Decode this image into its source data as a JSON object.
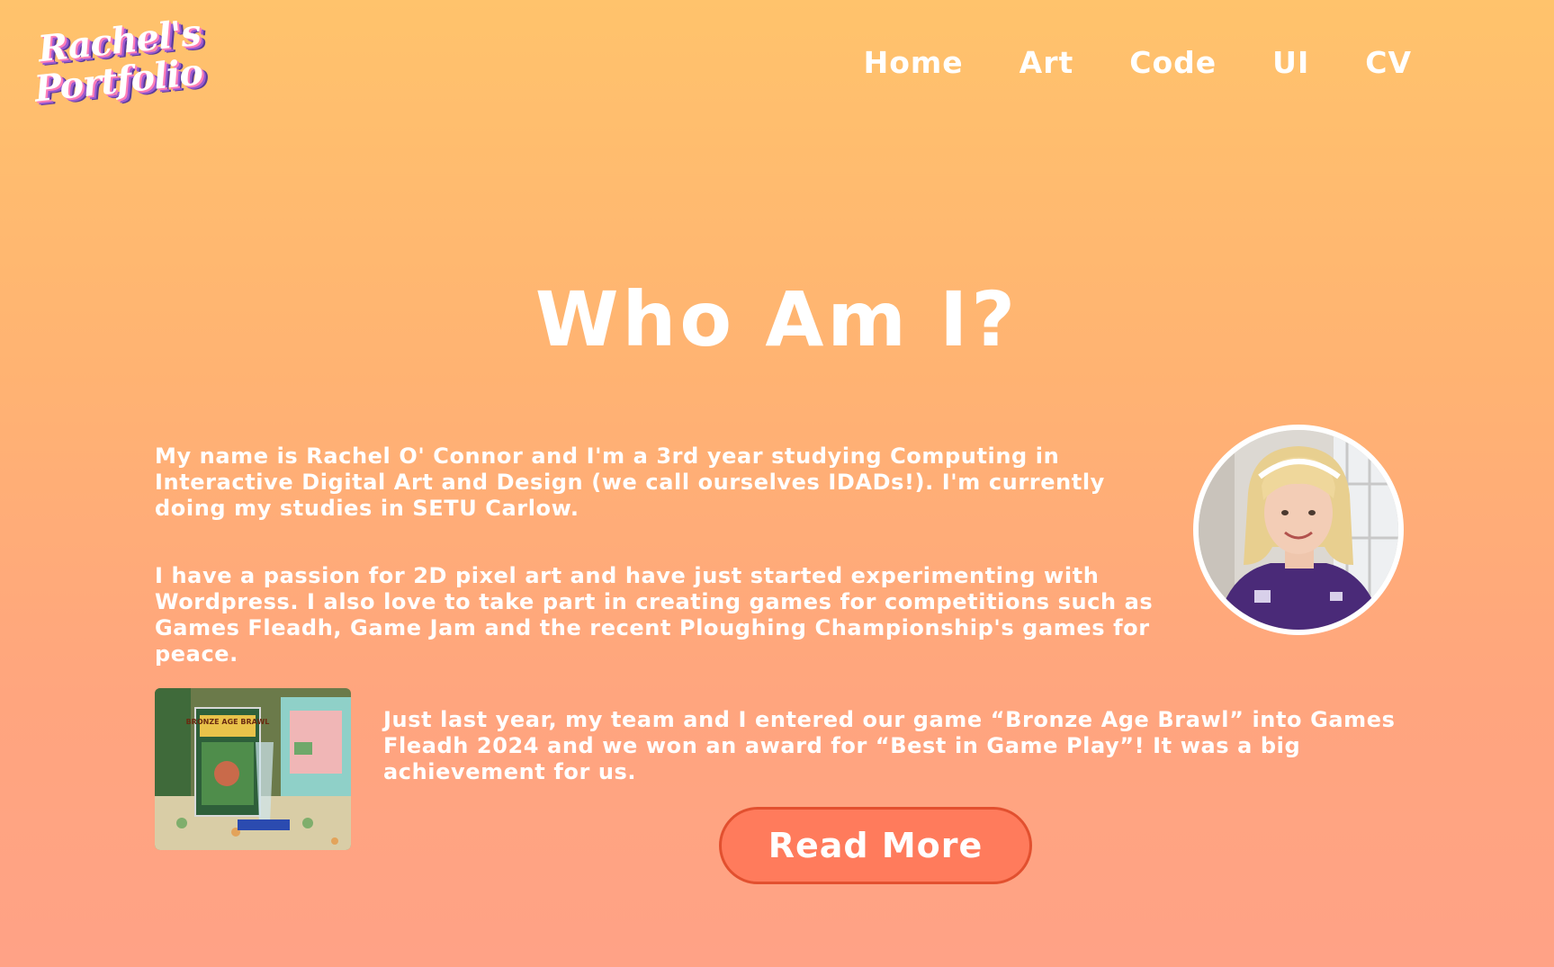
{
  "logo": {
    "line1": "Rachel's",
    "line2": "Portfolio"
  },
  "nav": {
    "items": [
      "Home",
      "Art",
      "Code",
      "UI",
      "CV"
    ]
  },
  "main": {
    "title": "Who Am I?",
    "paragraphs": [
      "My name is Rachel O' Connor and I'm a 3rd year studying Computing in Interactive Digital Art and Design (we call ourselves IDADs!). I'm currently doing my studies in SETU Carlow.",
      "I have a passion for 2D pixel art and have just started experimenting with Wordpress. I also love to take part in creating games for competitions such as Games Fleadh, Game Jam and the recent Ploughing Championship's games for peace.",
      "Just last year, my team and I entered our game “Bronze Age Brawl” into Games Fleadh 2024 and we won an award for “Best in Game Play”! It was a big achievement for us."
    ],
    "award_photo_text": "BRONZE AGE BRAWL",
    "read_more_label": "Read More"
  },
  "colors": {
    "background_top": "#ffc36c",
    "background_bottom": "#ffa286",
    "text": "#ffffff",
    "button": "#ff7b5c",
    "button_border": "#e2502f"
  }
}
